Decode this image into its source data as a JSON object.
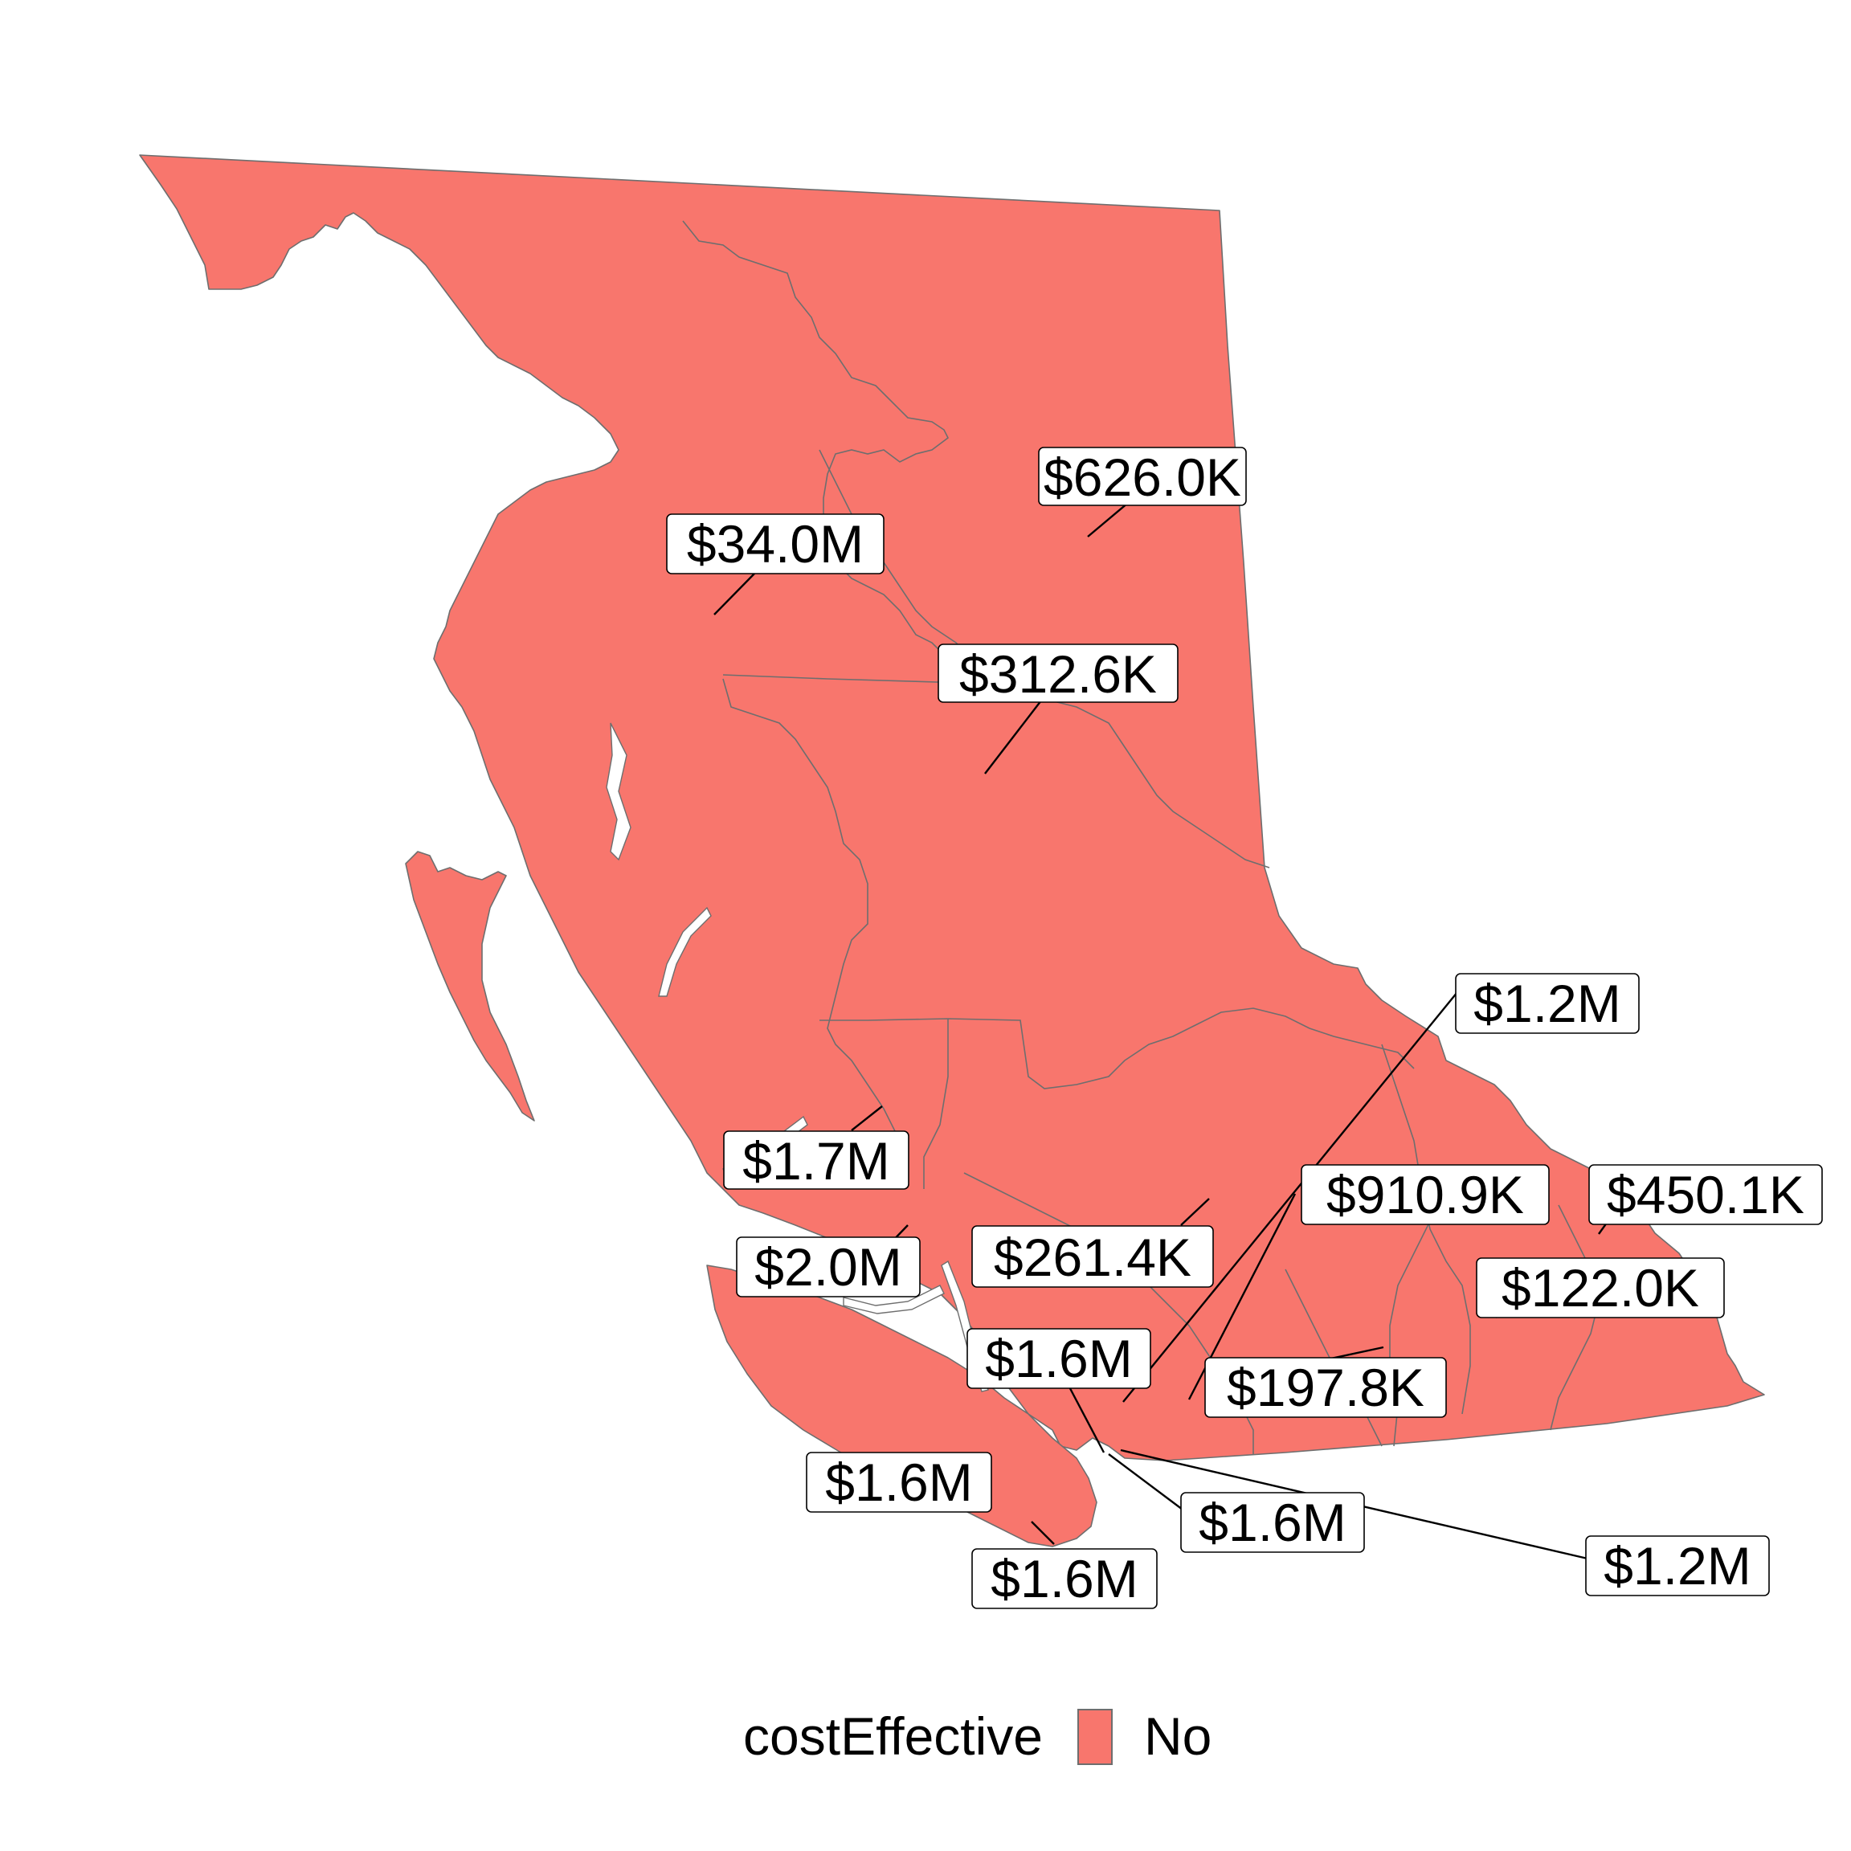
{
  "map": {
    "fill_color": "#F8766D",
    "border_color": "#6e6e6e"
  },
  "labels": [
    {
      "id": "northeast-a",
      "text": "$626.0K"
    },
    {
      "id": "stikine",
      "text": "$34.0M"
    },
    {
      "id": "northeast-b",
      "text": "$312.6K"
    },
    {
      "id": "east-1",
      "text": "$1.2M"
    },
    {
      "id": "coast-1",
      "text": "$1.7M"
    },
    {
      "id": "east-2",
      "text": "$910.9K"
    },
    {
      "id": "kootenay-1",
      "text": "$450.1K"
    },
    {
      "id": "coast-2",
      "text": "$2.0M"
    },
    {
      "id": "central",
      "text": "$261.4K"
    },
    {
      "id": "kootenay-2",
      "text": "$122.0K"
    },
    {
      "id": "lower-1",
      "text": "$1.6M"
    },
    {
      "id": "okanagan",
      "text": "$197.8K"
    },
    {
      "id": "island-1",
      "text": "$1.6M"
    },
    {
      "id": "lower-2",
      "text": "$1.6M"
    },
    {
      "id": "lower-3",
      "text": "$1.2M"
    },
    {
      "id": "island-2",
      "text": "$1.6M"
    }
  ],
  "legend": {
    "title": "costEffective",
    "items": [
      {
        "label": "No",
        "color": "#F8766D"
      }
    ]
  }
}
